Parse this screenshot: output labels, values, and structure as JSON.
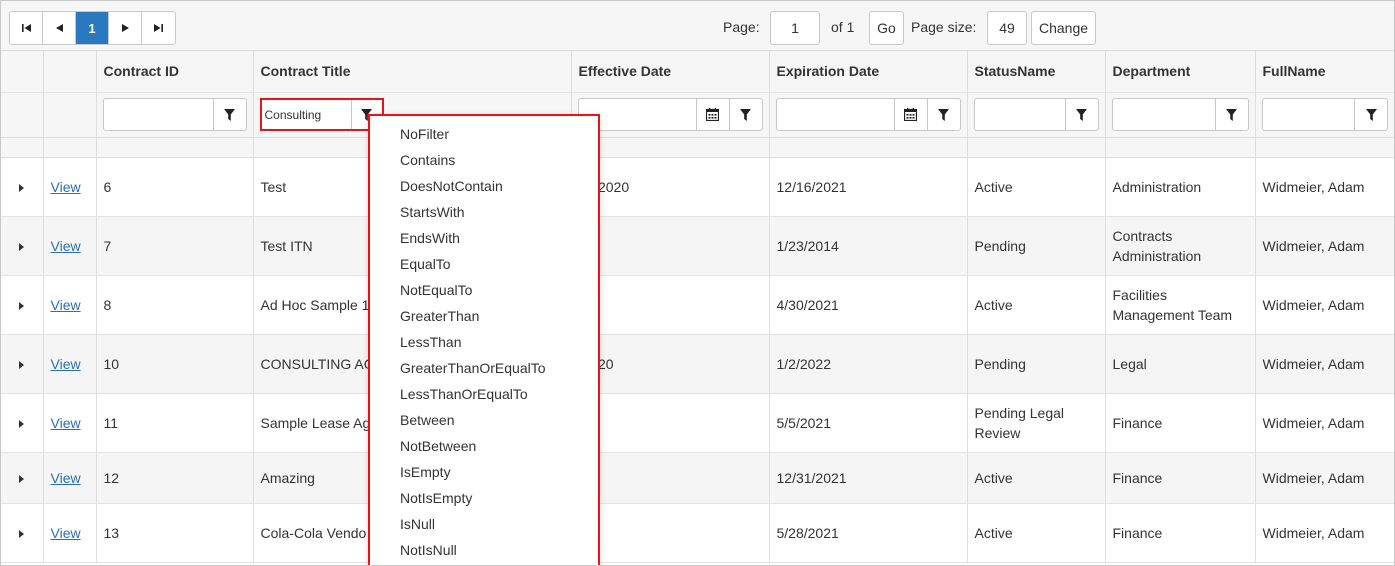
{
  "pager": {
    "first_icon": "first-page-icon",
    "prev_icon": "previous-page-icon",
    "current_page": "1",
    "next_icon": "next-page-icon",
    "last_icon": "last-page-icon",
    "page_label": "Page:",
    "page_value": "1",
    "of_label": "of 1",
    "go_label": "Go",
    "page_size_label": "Page size:",
    "page_size_value": "49",
    "change_label": "Change"
  },
  "columns": [
    "",
    "",
    "Contract ID",
    "Contract Title",
    "Effective Date",
    "Expiration Date",
    "StatusName",
    "Department",
    "FullName"
  ],
  "filters": {
    "contract_title_value": "Consulting",
    "filter_icon": "filter-icon",
    "calendar_icon": "calendar-icon"
  },
  "rows": [
    {
      "action": "View",
      "id": "6",
      "title": "Test",
      "effective": "16/2020",
      "expiration": "12/16/2021",
      "status": "Active",
      "department": "Administration",
      "fullname": "Widmeier, Adam"
    },
    {
      "action": "View",
      "id": "7",
      "title": "Test ITN",
      "effective": "",
      "expiration": "1/23/2014",
      "status": "Pending",
      "department": "Contracts Administration",
      "fullname": "Widmeier, Adam"
    },
    {
      "action": "View",
      "id": "8",
      "title": "Ad Hoc Sample 1",
      "effective": "",
      "expiration": "4/30/2021",
      "status": "Active",
      "department": "Facilities Management Team",
      "fullname": "Widmeier, Adam"
    },
    {
      "action": "View",
      "id": "10",
      "title": "CONSULTING AG",
      "effective": "/2020",
      "expiration": "1/2/2022",
      "status": "Pending",
      "department": "Legal",
      "fullname": "Widmeier, Adam"
    },
    {
      "action": "View",
      "id": "11",
      "title": "Sample Lease Ag",
      "effective": "",
      "expiration": "5/5/2021",
      "status": "Pending Legal Review",
      "department": "Finance",
      "fullname": "Widmeier, Adam"
    },
    {
      "action": "View",
      "id": "12",
      "title": "Amazing",
      "effective": "",
      "expiration": "12/31/2021",
      "status": "Active",
      "department": "Finance",
      "fullname": "Widmeier, Adam"
    },
    {
      "action": "View",
      "id": "13",
      "title": "Cola-Cola Vendo",
      "effective": "",
      "expiration": "5/28/2021",
      "status": "Active",
      "department": "Finance",
      "fullname": "Widmeier, Adam"
    }
  ],
  "filter_menu": [
    "NoFilter",
    "Contains",
    "DoesNotContain",
    "StartsWith",
    "EndsWith",
    "EqualTo",
    "NotEqualTo",
    "GreaterThan",
    "LessThan",
    "GreaterThanOrEqualTo",
    "LessThanOrEqualTo",
    "Between",
    "NotBetween",
    "IsEmpty",
    "NotIsEmpty",
    "IsNull",
    "NotIsNull"
  ],
  "colors": {
    "accent": "#2a78c0",
    "highlight": "#e8141a",
    "link": "#2a6ebb"
  }
}
